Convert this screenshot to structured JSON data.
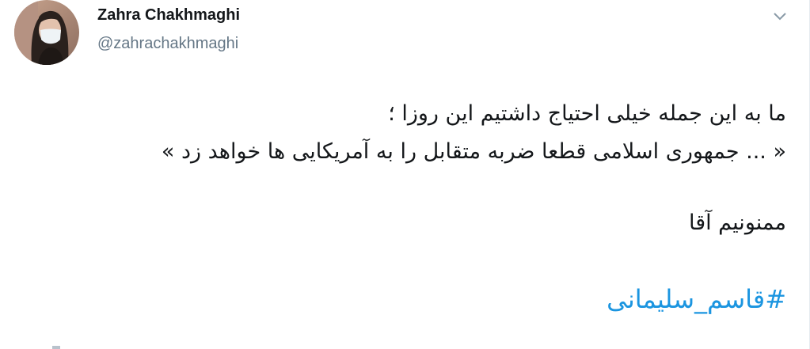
{
  "tweet": {
    "author": {
      "name": "Zahra Chakhmaghi",
      "handle": "@zahrachakhmaghi"
    },
    "menu_icon": "chevron-down-icon",
    "lines": [
      "ما به این جمله خیلی احتیاج داشتیم این روزا ؛",
      "« ... جمهوری اسلامی قطعا ضربه متقابل را به آمریکایی ها خواهد زد »",
      "ممنونیم آقا"
    ],
    "hashtag": "#قاسم_سلیمانی",
    "colors": {
      "text": "#14171a",
      "secondary": "#657786",
      "link": "#1b95e0"
    }
  }
}
